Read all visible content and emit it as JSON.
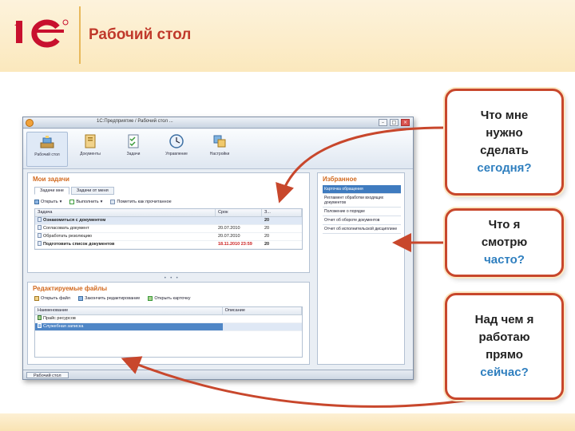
{
  "slide": {
    "title": "Рабочий стол",
    "colors": {
      "accent": "#c8472c",
      "highlight": "#2f7fbf",
      "header_bg": "#fbe8bd"
    }
  },
  "window": {
    "title": "1С:Предприятие / Рабочий стол ...",
    "toolbar": [
      {
        "label": "Рабочий стол",
        "icon": "desktop-icon"
      },
      {
        "label": "Документы",
        "icon": "documents-icon"
      },
      {
        "label": "Задачи",
        "icon": "tasks-icon"
      },
      {
        "label": "Управление",
        "icon": "clock-icon"
      },
      {
        "label": "Настройки",
        "icon": "settings-icon"
      }
    ],
    "tasks_panel": {
      "title": "Мои задачи",
      "tabs": [
        "Задачи мне",
        "Задачи от меня"
      ],
      "commands": [
        "Открыть",
        "Выполнить",
        "Пометить как прочитанное"
      ],
      "columns": [
        "Задача",
        "Срок",
        "З..."
      ],
      "rows": [
        {
          "task": "Ознакомиться с документом",
          "due": "",
          "count": "20",
          "bold": true,
          "selected": false
        },
        {
          "task": "Согласовать документ",
          "due": "20.07.2010",
          "count": "20",
          "bold": false,
          "selected": false
        },
        {
          "task": "Обработать резолюцию",
          "due": "20.07.2010",
          "count": "20",
          "bold": false,
          "selected": false
        },
        {
          "task": "Подготовить список документов",
          "due": "18.11.2010 23:59",
          "count": "20",
          "bold": true,
          "selected": false,
          "overdue": true
        }
      ]
    },
    "files_panel": {
      "title": "Редактируемые файлы",
      "commands": [
        "Открыть файл",
        "Закончить редактирование",
        "Открыть карточку"
      ],
      "columns": [
        "Наименование",
        "Описание"
      ],
      "rows": [
        {
          "name": "Прайс ресурсов",
          "desc": "",
          "selected": false
        },
        {
          "name": "Служебная записка",
          "desc": "",
          "selected": true
        }
      ]
    },
    "favorites_panel": {
      "title": "Избранное",
      "items": [
        {
          "text": "Карточка обращения",
          "selected": true
        },
        {
          "text": "Регламент обработки входящих документов",
          "selected": false
        },
        {
          "text": "Положение о порядке",
          "selected": false
        },
        {
          "text": "Отчет об обороте документов",
          "selected": false
        },
        {
          "text": "Отчет об исполнительской дисциплине",
          "selected": false
        }
      ]
    },
    "status_tab": "Рабочий стол"
  },
  "callouts": [
    {
      "lines": [
        "Что мне",
        "нужно",
        "сделать"
      ],
      "highlight": "сегодня?"
    },
    {
      "lines": [
        "Что я",
        "смотрю"
      ],
      "highlight": "часто?"
    },
    {
      "lines": [
        "Над чем я",
        "работаю",
        "прямо"
      ],
      "highlight": "сейчас?"
    }
  ]
}
